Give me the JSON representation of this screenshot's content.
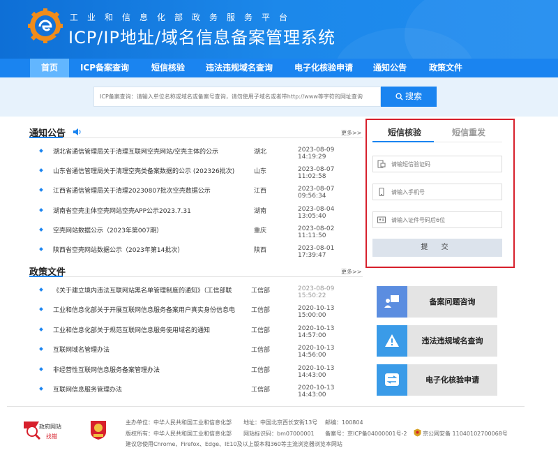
{
  "header": {
    "subtitle": "工业和信息化部政务服务平台",
    "title": "ICP/IP地址/域名信息备案管理系统"
  },
  "nav": {
    "items": [
      {
        "label": "首页",
        "active": true
      },
      {
        "label": "ICP备案查询",
        "active": false
      },
      {
        "label": "短信核验",
        "active": false
      },
      {
        "label": "违法违规域名查询",
        "active": false
      },
      {
        "label": "电子化核验申请",
        "active": false
      },
      {
        "label": "通知公告",
        "active": false
      },
      {
        "label": "政策文件",
        "active": false
      }
    ]
  },
  "search": {
    "placeholder": "ICP备案查询：请输入单位名称或域名或备案号查询，请勿使用子域名或者带http://www等字符的网址查询",
    "button_label": "搜索"
  },
  "notices": {
    "title": "通知公告",
    "more_label": "更多>>",
    "items": [
      {
        "title": "湖北省通信管理局关于清理互联网空壳网站/空壳主体的公示",
        "region": "湖北",
        "date": "2023-08-09 14:19:29"
      },
      {
        "title": "山东省通信管理局关于清理空壳类备案数据的公示 (202326批次)",
        "region": "山东",
        "date": "2023-08-07 11:02:58"
      },
      {
        "title": "江西省通信管理局关于清理20230807批次空壳数据公示",
        "region": "江西",
        "date": "2023-08-07 09:56:34"
      },
      {
        "title": "湖南省空壳主体空壳网站空壳APP公示2023.7.31",
        "region": "湖南",
        "date": "2023-08-04 13:05:40"
      },
      {
        "title": "空壳网站数据公示（2023年第007期）",
        "region": "重庆",
        "date": "2023-08-02 11:11:50"
      },
      {
        "title": "陕西省空壳网站数据公示（2023年第14批次）",
        "region": "陕西",
        "date": "2023-08-01 17:39:47"
      }
    ]
  },
  "policies": {
    "title": "政策文件",
    "more_label": "更多>>",
    "items": [
      {
        "title": "《关于建立境内违法互联网站黑名单管理制度的通知》（工信部联",
        "region": "工信部",
        "date": "2023-08-09 15:50:22"
      },
      {
        "title": "工业和信息化部关于开展互联网信息服务备案用户真实身份信息电",
        "region": "工信部",
        "date": "2020-10-13 15:00:00"
      },
      {
        "title": "工业和信息化部关于规范互联网信息服务使用域名的通知",
        "region": "工信部",
        "date": "2020-10-13 14:57:00"
      },
      {
        "title": "互联网域名管理办法",
        "region": "工信部",
        "date": "2020-10-13 14:56:00"
      },
      {
        "title": "非经营性互联网信息服务备案管理办法",
        "region": "工信部",
        "date": "2020-10-13 14:43:00"
      },
      {
        "title": "互联网信息服务管理办法",
        "region": "工信部",
        "date": "2020-10-13 14:43:00"
      }
    ]
  },
  "sms": {
    "tab_verify": "短信核验",
    "tab_resend": "短信重发",
    "code_placeholder": "请输短信验证码",
    "phone_placeholder": "请输入手机号",
    "id_placeholder": "请输入证件号码后6位",
    "submit_label": "提 交"
  },
  "quick_links": [
    {
      "label": "备案问题咨询",
      "icon": "consult-icon",
      "color": "#5b8de0"
    },
    {
      "label": "违法违规域名查询",
      "icon": "warning-icon",
      "color": "#3a9be8"
    },
    {
      "label": "电子化核验申请",
      "icon": "transfer-icon",
      "color": "#3a9be8"
    }
  ],
  "footer": {
    "gov_site_label": "政府网站",
    "find_error_label": "找错",
    "sponsor": "主办单位：中华人民共和国工业和信息化部",
    "address": "地址：中国北京西长安街13号",
    "postcode": "邮编：100804",
    "copyright": "版权所有：中华人民共和国工业和信息化部",
    "site_code": "网站标识码：bm07000001",
    "icp_no": "备案号：京ICP备04000001号-2",
    "police_no": "京公网安备 11040102700068号",
    "browser_tip": "建议您使用Chrome、Firefox、Edge、IE10及以上版本和360等主流浏览器浏览本网站"
  },
  "colors": {
    "brand_blue": "#1a84f0",
    "nav_active": "#62b6ff",
    "highlight_red": "#d7202c"
  }
}
